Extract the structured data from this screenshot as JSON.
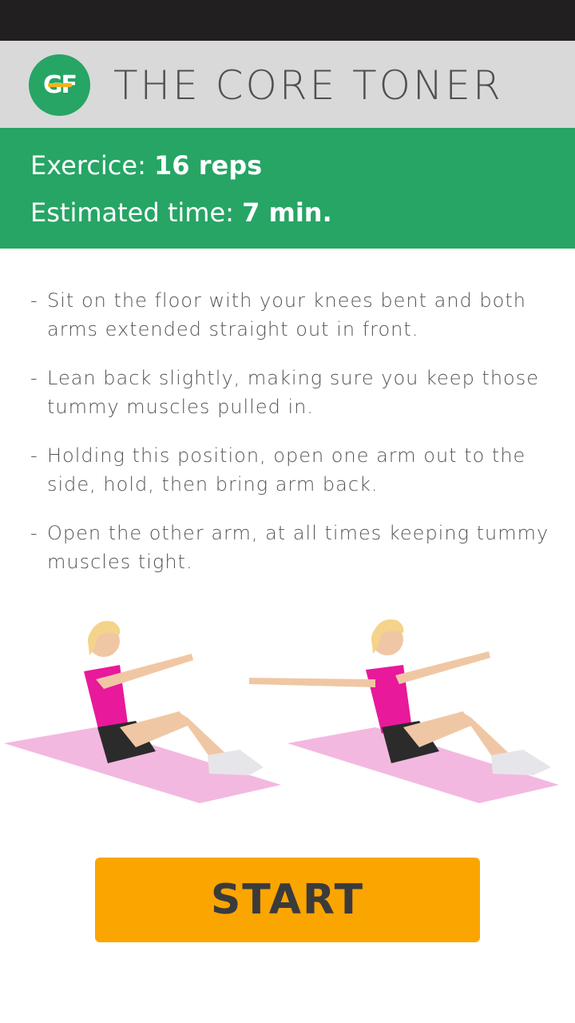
{
  "header": {
    "logo_text": "GF",
    "title": "THE CORE TONER"
  },
  "info": {
    "reps_label": "Exercice: ",
    "reps_value": "16 reps",
    "time_label": "Estimated time: ",
    "time_value": "7 min."
  },
  "instructions": [
    {
      "dash": "-",
      "text": "Sit on the floor with your knees bent and both arms extended straight out in front."
    },
    {
      "dash": "-",
      "text": "Lean back slightly, making sure you keep those tummy muscles pulled in."
    },
    {
      "dash": "-",
      "text": "Holding this position, open one arm out to the side, hold, then bring arm back."
    },
    {
      "dash": "-",
      "text": "Open the other arm, at all times keeping tummy muscles tight."
    }
  ],
  "start_button": {
    "label": "START"
  },
  "colors": {
    "status_bar": "#221f20",
    "header_bg": "#d9d9d9",
    "brand_green": "#26a565",
    "start_orange": "#fba500",
    "text_gray": "#555555",
    "outfit_pink": "#e8199b",
    "mat_pink": "#f3b8e0"
  }
}
